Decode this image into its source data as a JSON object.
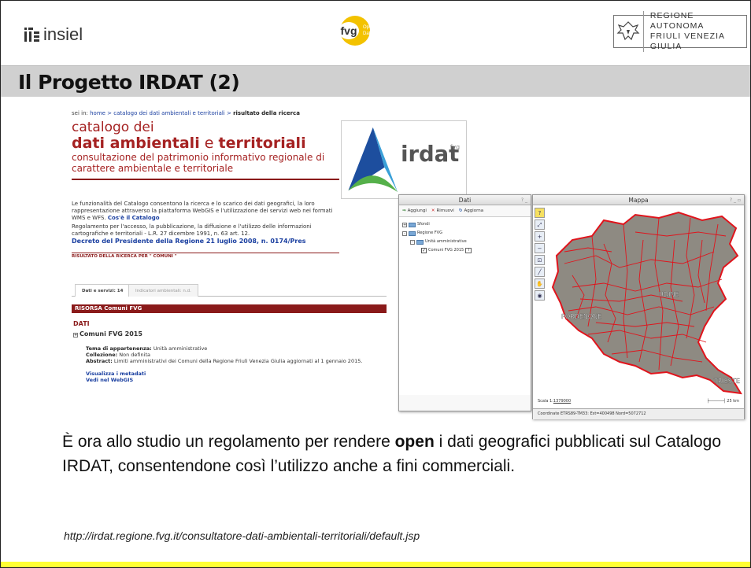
{
  "header": {
    "insiel_label": "insiel",
    "fvg_logo": {
      "main": "fvg",
      "badge_line1": "Open",
      "badge_line2": "Data"
    },
    "regione_line1": "REGIONE AUTONOMA",
    "regione_line2": "FRIULI VENEZIA GIULIA"
  },
  "slide": {
    "title": "Il Progetto IRDAT (2)",
    "body_before": "È ora allo studio un regolamento per rendere ",
    "body_bold": "open",
    "body_after": " i dati geografici pubblicati sul Catalogo IRDAT, consentendone così l’utilizzo anche a fini commerciali.",
    "url": "http://irdat.regione.fvg.it/consultatore-dati-ambientali-territoriali/default.jsp"
  },
  "catalog": {
    "crumb_prefix": "sei in: ",
    "crumb_path": "home > catalogo dei dati ambientali e territoriali > ",
    "crumb_current": "risultato della ricerca",
    "title_line1": "catalogo dei",
    "title_bold1": "dati ambientali",
    "title_mid": " e ",
    "title_bold2": "territoriali",
    "subtitle": "consultazione del patrimonio informativo regionale di carattere ambientale e territoriale",
    "irdat_logo_text": "irdat",
    "irdat_logo_sup": "fvg",
    "intro1": "Le funzionalità del Catalogo consentono la ricerca e lo scarico dei dati geografici, la loro rappresentazione attraverso la piattaforma WebGIS e l'utilizzazione dei servizi web nei formati WMS e WFS.",
    "intro1_link": "Cos'è il Catalogo",
    "intro2": "Regolamento per l'accesso, la pubblicazione, la diffusione e l'utilizzo delle informazioni cartografiche e territoriali - L.R. 27 dicembre 1991, n. 63 art. 12.",
    "decree": "Decreto del Presidente della Regione 21 luglio 2008, n. 0174/Pres",
    "result_label": "RISULTATO DELLA RICERCA PER \" COMUNI \"",
    "tab1": "Dati e servizi: 14",
    "tab2": "Indicatori ambientali: n.d.",
    "risorsa": "RISORSA Comuni FVG",
    "dati_heading": "DATI",
    "comuni_item": "Comuni FVG 2015",
    "tema_label": "Tema di appartenenza:",
    "tema_value": " Unità amministrative",
    "collezione_label": "Collezione:",
    "collezione_value": " Non definita",
    "abstract_label": "Abstract:",
    "abstract_value": " Limiti amministrativi dei Comuni della Regione Friuli Venezia Giulia aggiornati al 1 gennaio 2015.",
    "link_metadati": "Visualizza i metadati",
    "link_webgis": "Vedi nel WebGIS"
  },
  "dati_window": {
    "title": "Dati",
    "controls": "? _",
    "btn_add": "Aggiungi",
    "btn_remove": "Rimuovi",
    "btn_refresh": "Aggiorna",
    "tree": [
      {
        "label": "Sfondi",
        "level": 0,
        "expander": "+"
      },
      {
        "label": "Regione FVG",
        "level": 0,
        "expander": "-"
      },
      {
        "label": "Unità amministrative",
        "level": 1,
        "expander": "-"
      },
      {
        "label": "Comuni FVG 2015",
        "level": 2,
        "checked": true
      }
    ]
  },
  "mappa_window": {
    "title": "Mappa",
    "controls": "? _ ▫",
    "city_labels": [
      "UDINE",
      "PORDENONE",
      "TRIESTE"
    ],
    "scale_label": "Scala 1:",
    "scale_value": "1379000",
    "scalebar_label": "25 km",
    "status": "Coordinate ETRS89-TM33: Est=400498  Nord=5072712",
    "boundary_color": "#e0141c",
    "terrain_color": "#8e8a82"
  }
}
